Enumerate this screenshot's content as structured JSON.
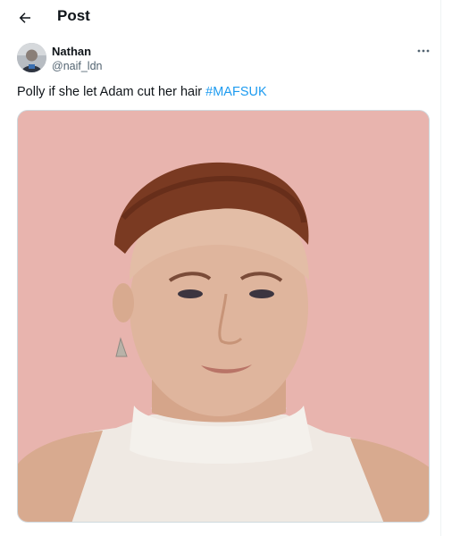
{
  "header": {
    "title": "Post"
  },
  "post": {
    "author": {
      "display_name": "Nathan",
      "handle": "@naif_ldn"
    },
    "text": "Polly if she let Adam cut her hair ",
    "hashtag": "#MAFSUK"
  },
  "icons": {
    "back": "arrow-left-icon",
    "more": "more-horizontal-icon"
  },
  "colors": {
    "accent": "#1d9bf0",
    "media_background": "#e8b4ae",
    "text_secondary": "#536471"
  }
}
